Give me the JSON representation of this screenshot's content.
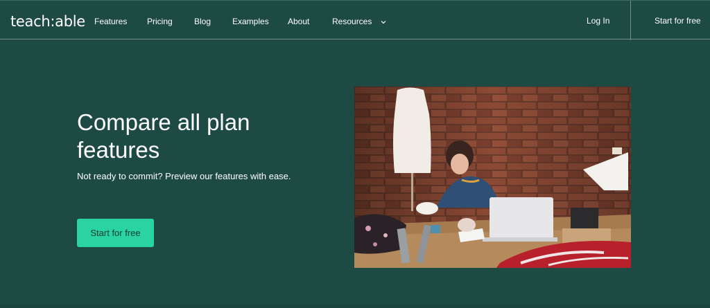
{
  "header": {
    "logo": "teach:able",
    "nav": [
      {
        "label": "Features"
      },
      {
        "label": "Pricing"
      },
      {
        "label": "Blog"
      },
      {
        "label": "Examples"
      },
      {
        "label": "About"
      },
      {
        "label": "Resources"
      }
    ],
    "login": "Log In",
    "start": "Start for free"
  },
  "hero": {
    "title": "Compare all plan features",
    "subtitle": "Not ready to commit? Preview our features with ease.",
    "cta": "Start for free"
  },
  "colors": {
    "background": "#1d4b43",
    "accent": "#2ad4a2",
    "text": "#ffffff"
  }
}
